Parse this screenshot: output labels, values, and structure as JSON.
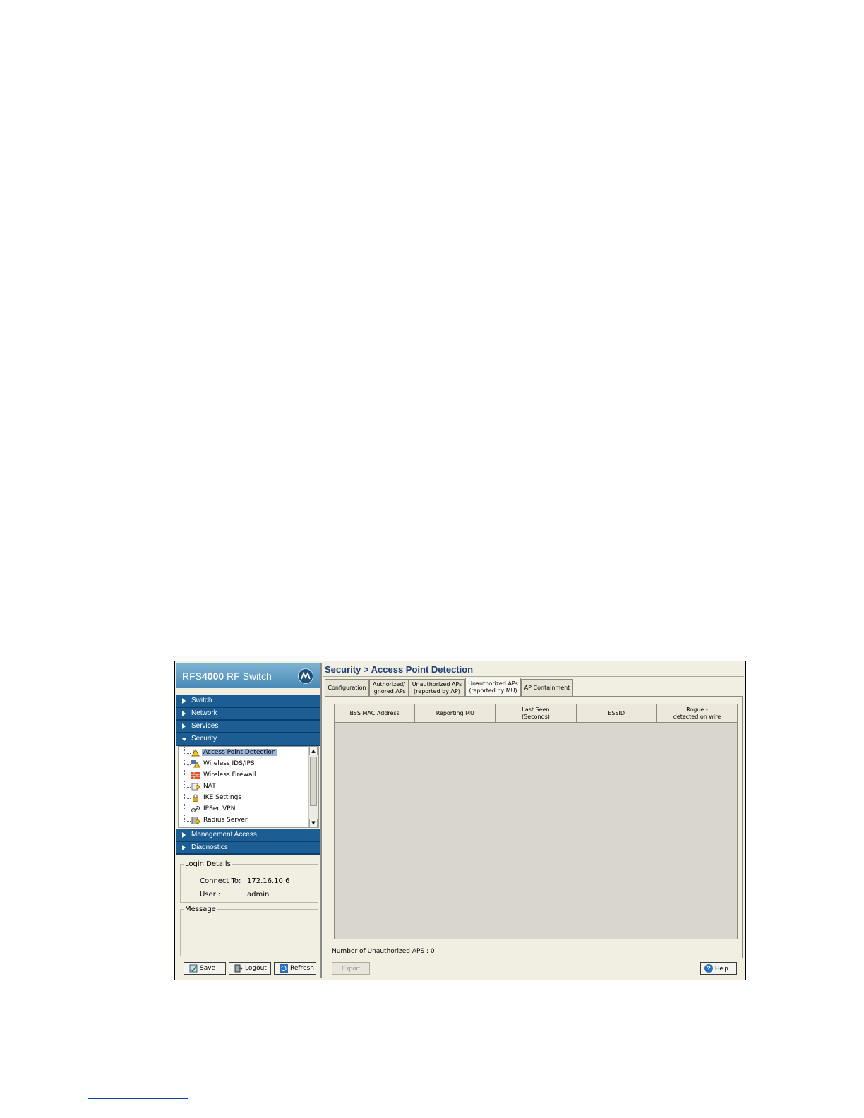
{
  "app": {
    "brand_prefix": "RFS",
    "brand_model": "4000",
    "brand_suffix": "RF Switch"
  },
  "nav": {
    "switch": "Switch",
    "network": "Network",
    "services": "Services",
    "security": "Security",
    "management_access": "Management Access",
    "diagnostics": "Diagnostics"
  },
  "tree": {
    "items": [
      {
        "label": "Access Point Detection",
        "icon": "access-point-detection-icon",
        "selected": true
      },
      {
        "label": "Wireless IDS/IPS",
        "icon": "wireless-ids-icon"
      },
      {
        "label": "Wireless Firewall",
        "icon": "firewall-icon"
      },
      {
        "label": "NAT",
        "icon": "nat-icon"
      },
      {
        "label": "IKE Settings",
        "icon": "lock-icon"
      },
      {
        "label": "IPSec VPN",
        "icon": "vpn-icon"
      },
      {
        "label": "Radius Server",
        "icon": "radius-server-icon"
      }
    ]
  },
  "login": {
    "legend": "Login Details",
    "connect_label": "Connect To:",
    "connect_value": "172.16.10.6",
    "user_label": "User :",
    "user_value": "admin"
  },
  "message": {
    "legend": "Message"
  },
  "buttons": {
    "save": "Save",
    "logout": "Logout",
    "refresh": "Refresh",
    "export": "Export",
    "help": "Help"
  },
  "page": {
    "title": "Security > Access Point Detection"
  },
  "tabs": [
    {
      "label": "Configuration"
    },
    {
      "label": "Authorized/\nIgnored APs"
    },
    {
      "label": "Unauthorized APs\n(reported by AP)"
    },
    {
      "label": "Unauthorized APs\n(reported by MU)",
      "active": true
    },
    {
      "label": "AP Containment"
    }
  ],
  "table": {
    "columns": [
      "BSS MAC Address",
      "Reporting MU",
      "Last Seen\n(Seconds)",
      "ESSID",
      "Rogue -\ndetected on wire"
    ],
    "rows": []
  },
  "summary": {
    "count_text": "Number of Unauthorized APS : 0"
  },
  "colors": {
    "accent": "#1c5e93",
    "title": "#1d3f7a",
    "panel_bg": "#f1efe2"
  }
}
